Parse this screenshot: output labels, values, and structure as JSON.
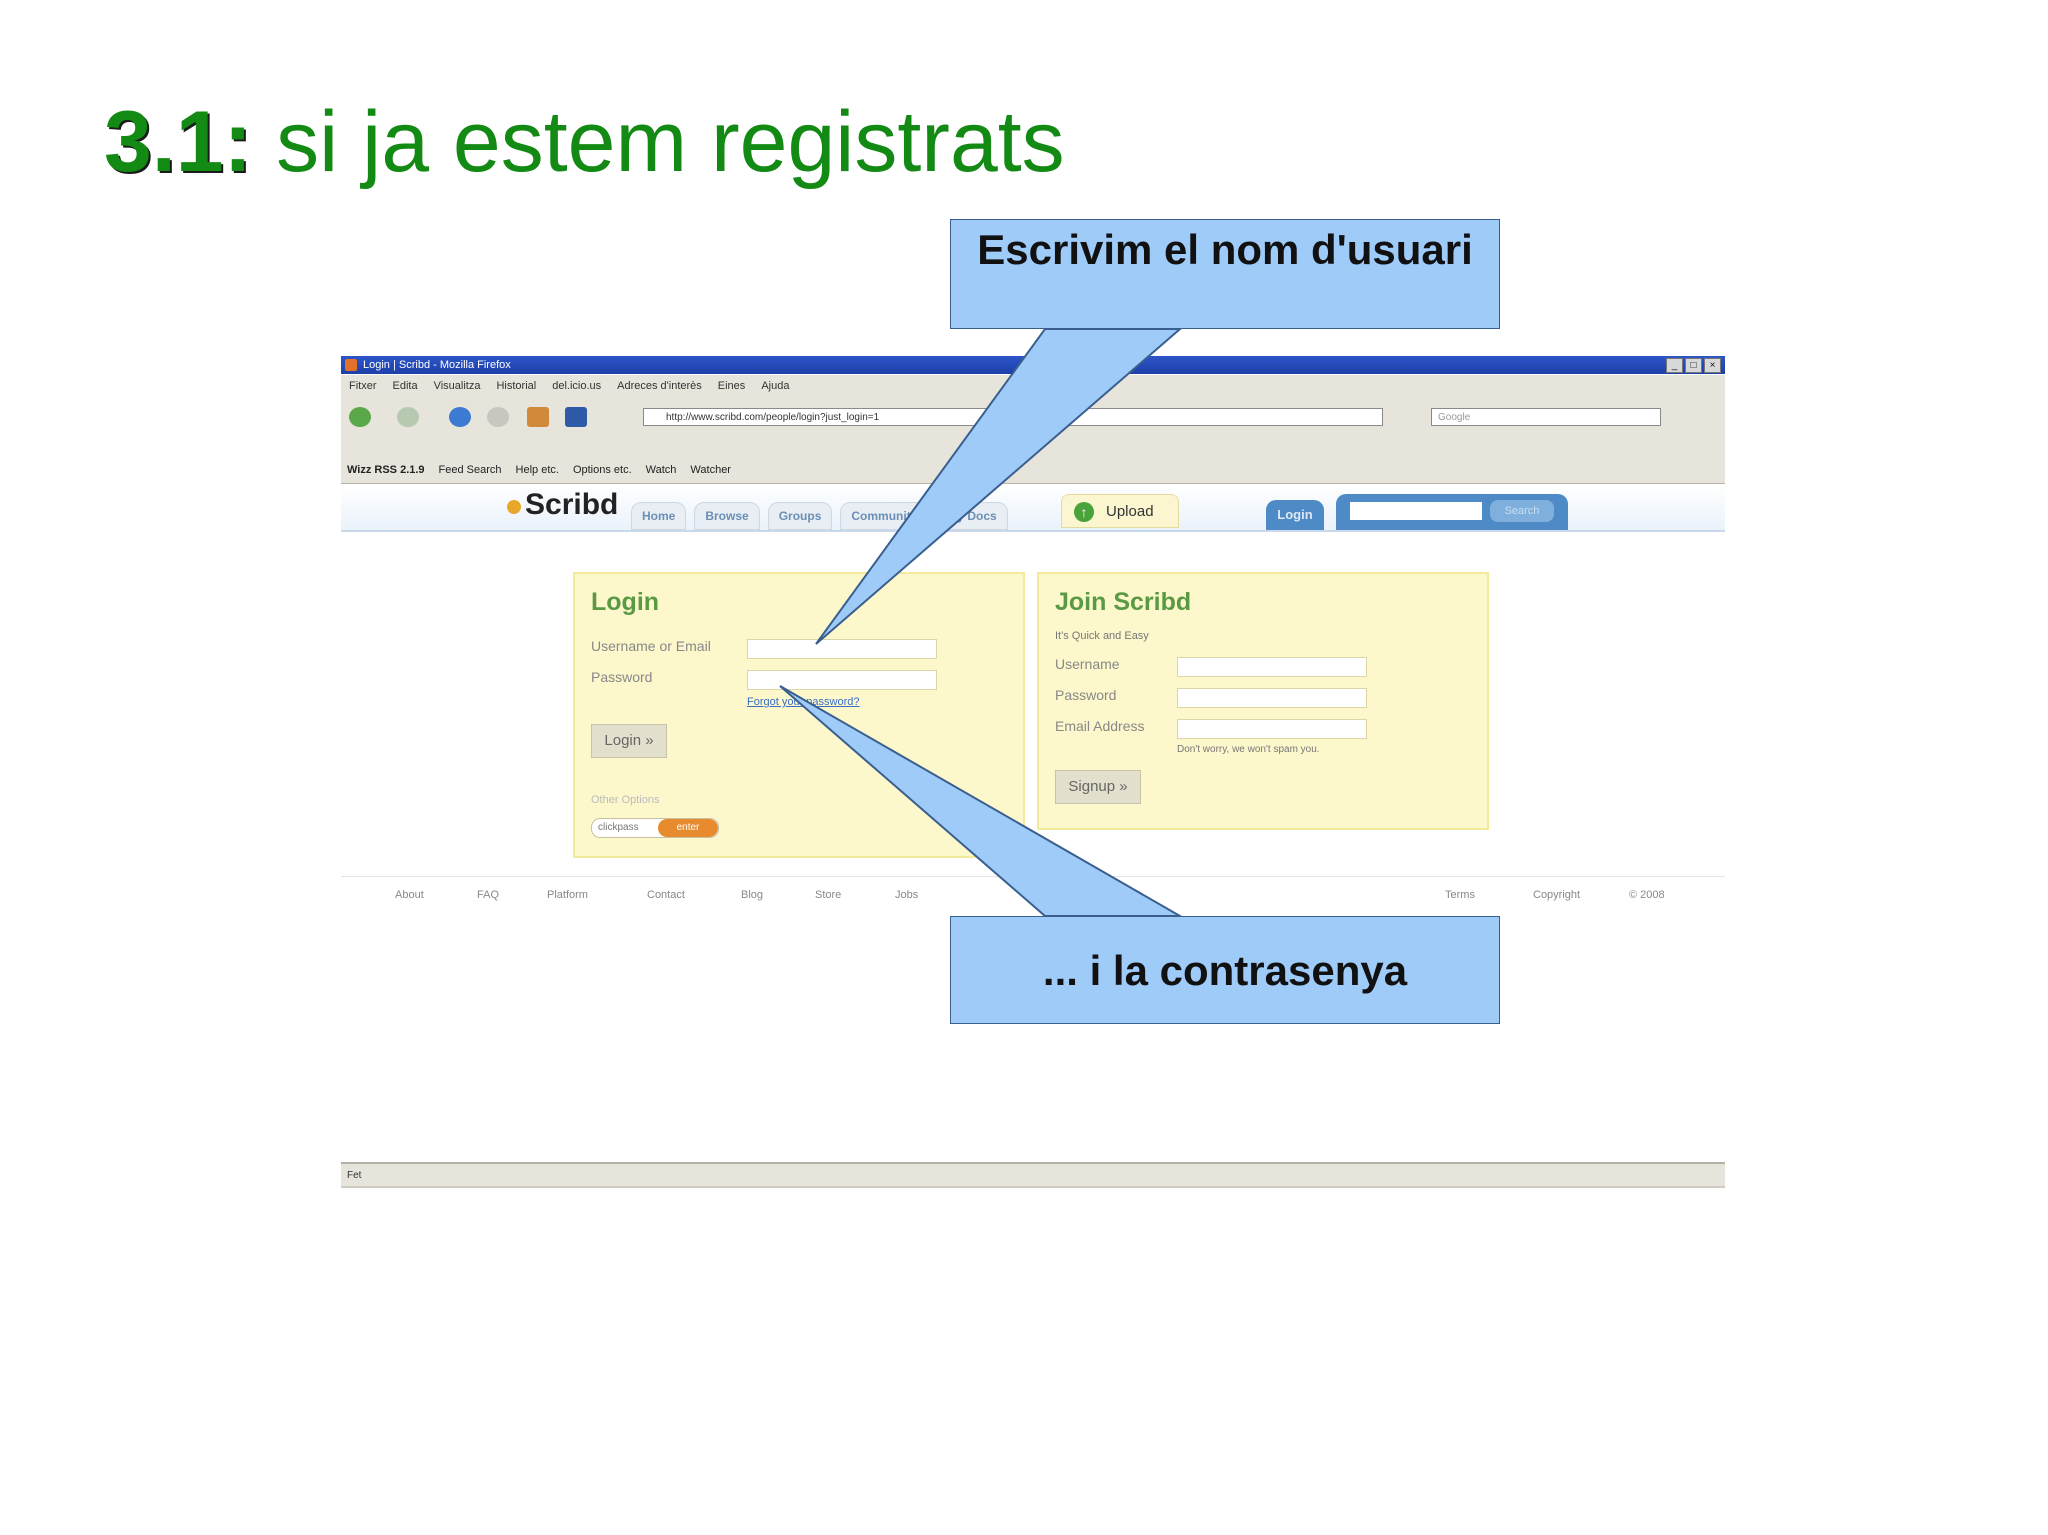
{
  "slide": {
    "title_number": "3.1:",
    "title_text": " si ja estem registrats"
  },
  "browser": {
    "window_title": "Login | Scribd - Mozilla Firefox",
    "window_controls": [
      "_",
      "□",
      "×"
    ],
    "menu": [
      "Fitxer",
      "Edita",
      "Visualitza",
      "Historial",
      "del.icio.us",
      "Adreces d'interès",
      "Eines",
      "Ajuda"
    ],
    "url": "http://www.scribd.com/people/login?just_login=1",
    "search_placeholder": "Google",
    "toolbar_items": [
      "Wizz RSS 2.1.9",
      "Feed Search",
      "Help etc.",
      "Options etc.",
      "Watch",
      "Watcher"
    ],
    "status_text": "Fet"
  },
  "site": {
    "logo": "Scribd",
    "tabs": [
      "Home",
      "Browse",
      "Groups",
      "Community",
      "My Docs"
    ],
    "upload_label": "Upload",
    "login_tab": "Login",
    "search_button": "Search",
    "login_panel": {
      "heading": "Login",
      "username_label": "Username or Email",
      "password_label": "Password",
      "forgot_link": "Forgot your password?",
      "login_button": "Login »",
      "other_options": "Other Options",
      "clickpass": "clickpass",
      "enter": "enter"
    },
    "join_panel": {
      "heading": "Join Scribd",
      "subheading": "It's Quick and Easy",
      "username_label": "Username",
      "password_label": "Password",
      "email_label": "Email Address",
      "spam_note": "Don't worry, we won't spam you.",
      "signup_button": "Signup »"
    },
    "footer_links": [
      "About",
      "FAQ",
      "Platform",
      "Contact",
      "Blog",
      "Store",
      "Jobs"
    ],
    "footer_right": [
      "Terms",
      "Copyright",
      "© 2008"
    ]
  },
  "callouts": {
    "username": "Escrivim el nom d'usuari",
    "password": "... i la contrasenya"
  },
  "colors": {
    "title_green": "#138a13",
    "callout_fill": "#9fcbf9",
    "panel_yellow": "#fdf7cc"
  }
}
